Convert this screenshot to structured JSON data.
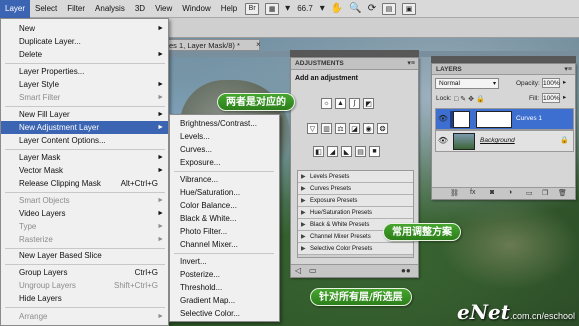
{
  "menubar": {
    "items": [
      "Layer",
      "Select",
      "Filter",
      "Analysis",
      "3D",
      "View",
      "Window",
      "Help"
    ],
    "zoom": "66.7"
  },
  "document_tab": {
    "label": "es 1, Layer Mask/8) *"
  },
  "layer_menu": {
    "items": [
      {
        "label": "New",
        "shortcut": "",
        "submenu": true,
        "enabled": true
      },
      {
        "label": "Duplicate Layer...",
        "shortcut": "",
        "submenu": false,
        "enabled": true
      },
      {
        "label": "Delete",
        "shortcut": "",
        "submenu": true,
        "enabled": true
      },
      {
        "label": "Layer Properties...",
        "shortcut": "",
        "submenu": false,
        "enabled": true
      },
      {
        "label": "Layer Style",
        "shortcut": "",
        "submenu": true,
        "enabled": true
      },
      {
        "label": "Smart Filter",
        "shortcut": "",
        "submenu": true,
        "enabled": false
      },
      {
        "label": "New Fill Layer",
        "shortcut": "",
        "submenu": true,
        "enabled": true
      },
      {
        "label": "New Adjustment Layer",
        "shortcut": "",
        "submenu": true,
        "enabled": true,
        "selected": true
      },
      {
        "label": "Layer Content Options...",
        "shortcut": "",
        "submenu": false,
        "enabled": true
      },
      {
        "label": "Layer Mask",
        "shortcut": "",
        "submenu": true,
        "enabled": true
      },
      {
        "label": "Vector Mask",
        "shortcut": "",
        "submenu": true,
        "enabled": true
      },
      {
        "label": "Release Clipping Mask",
        "shortcut": "Alt+Ctrl+G",
        "submenu": false,
        "enabled": true
      },
      {
        "label": "Smart Objects",
        "shortcut": "",
        "submenu": true,
        "enabled": false
      },
      {
        "label": "Video Layers",
        "shortcut": "",
        "submenu": true,
        "enabled": true
      },
      {
        "label": "Type",
        "shortcut": "",
        "submenu": true,
        "enabled": false
      },
      {
        "label": "Rasterize",
        "shortcut": "",
        "submenu": true,
        "enabled": false
      },
      {
        "label": "New Layer Based Slice",
        "shortcut": "",
        "submenu": false,
        "enabled": true
      },
      {
        "label": "Group Layers",
        "shortcut": "Ctrl+G",
        "submenu": false,
        "enabled": true
      },
      {
        "label": "Ungroup Layers",
        "shortcut": "Shift+Ctrl+G",
        "submenu": false,
        "enabled": false
      },
      {
        "label": "Hide Layers",
        "shortcut": "",
        "submenu": false,
        "enabled": true
      },
      {
        "label": "Arrange",
        "shortcut": "",
        "submenu": true,
        "enabled": false
      }
    ]
  },
  "adjustment_submenu": {
    "items": [
      "Brightness/Contrast...",
      "Levels...",
      "Curves...",
      "Exposure...",
      "Vibrance...",
      "Hue/Saturation...",
      "Color Balance...",
      "Black & White...",
      "Photo Filter...",
      "Channel Mixer...",
      "Invert...",
      "Posterize...",
      "Threshold...",
      "Gradient Map...",
      "Selective Color..."
    ]
  },
  "adjustments_panel": {
    "title": "ADJUSTMENTS",
    "subtitle": "Add an adjustment",
    "presets": [
      "Levels Presets",
      "Curves Presets",
      "Exposure Presets",
      "Hue/Saturation Presets",
      "Black & White Presets",
      "Channel Mixer Presets",
      "Selective Color Presets"
    ]
  },
  "layers_panel": {
    "title": "LAYERS",
    "blend_mode": "Normal",
    "opacity_label": "Opacity:",
    "opacity_value": "100%",
    "lock_label": "Lock:",
    "fill_label": "Fill:",
    "fill_value": "100%",
    "layers": [
      {
        "name": "Curves 1",
        "selected": true
      },
      {
        "name": "Background",
        "selected": false
      }
    ]
  },
  "callouts": {
    "corresponding": "两者是对应的",
    "common_presets": "常用调整方案",
    "all_layers": "针对所有层/所选层"
  },
  "watermark": {
    "brand": "eNet",
    "url": ".com.cn/eschool"
  }
}
